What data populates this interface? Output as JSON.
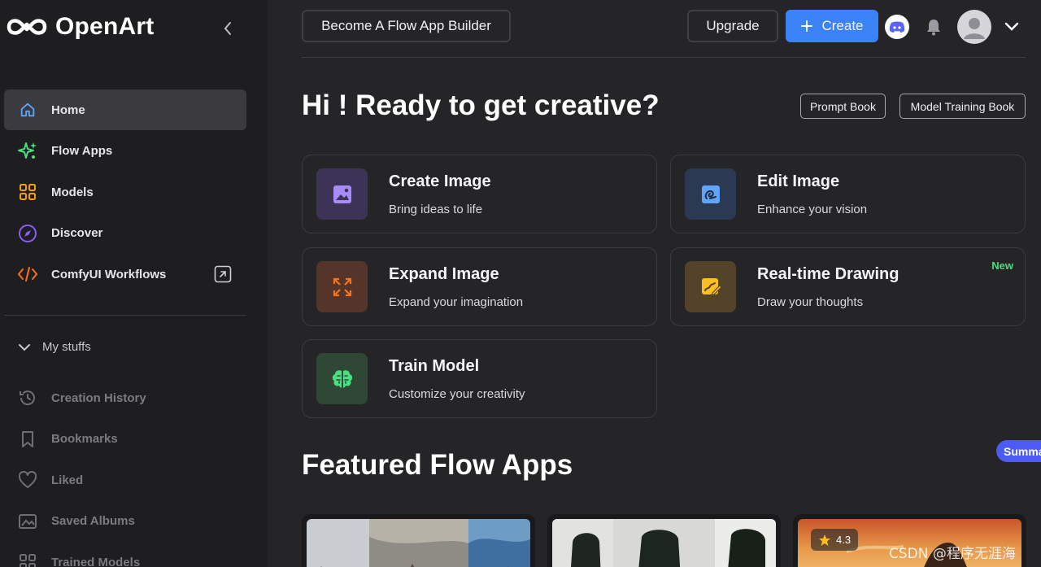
{
  "brand": {
    "name": "OpenArt"
  },
  "sidebar": {
    "nav": [
      {
        "label": "Home",
        "icon": "home-icon",
        "color": "#60a5fa"
      },
      {
        "label": "Flow Apps",
        "icon": "sparkle-icon",
        "color": "#4ade80"
      },
      {
        "label": "Models",
        "icon": "grid-icon",
        "color": "#f59e0b"
      },
      {
        "label": "Discover",
        "icon": "compass-icon",
        "color": "#8b5cf6"
      },
      {
        "label": "ComfyUI Workflows",
        "icon": "code-icon",
        "color": "#f97316"
      }
    ],
    "my_stuffs_label": "My stuffs",
    "stuffs": [
      {
        "label": "Creation History",
        "icon": "history-icon"
      },
      {
        "label": "Bookmarks",
        "icon": "bookmark-icon"
      },
      {
        "label": "Liked",
        "icon": "heart-icon"
      },
      {
        "label": "Saved Albums",
        "icon": "album-icon"
      },
      {
        "label": "Trained Models",
        "icon": "trained-models-icon"
      }
    ]
  },
  "topbar": {
    "builder_label": "Become A Flow App Builder",
    "upgrade_label": "Upgrade",
    "create_label": "Create",
    "accent": "#3b82f6"
  },
  "main": {
    "greeting": "Hi ! Ready to get creative?",
    "prompt_book": "Prompt Book",
    "model_training_book": "Model Training Book",
    "cards": [
      {
        "title": "Create Image",
        "desc": "Bring ideas to life",
        "icon": "image-icon",
        "bg": "#3d3356",
        "fg": "#a78bfa",
        "badge": ""
      },
      {
        "title": "Edit Image",
        "desc": "Enhance your vision",
        "icon": "edit-image-icon",
        "bg": "#2b3a52",
        "fg": "#60a5fa",
        "badge": ""
      },
      {
        "title": "Expand Image",
        "desc": "Expand your imagination",
        "icon": "expand-icon",
        "bg": "#553529",
        "fg": "#f97316",
        "badge": ""
      },
      {
        "title": "Real-time Drawing",
        "desc": "Draw your thoughts",
        "icon": "drawing-icon",
        "bg": "#52432a",
        "fg": "#fbbf24",
        "badge": "New"
      },
      {
        "title": "Train Model",
        "desc": "Customize your creativity",
        "icon": "brain-icon",
        "bg": "#2f4836",
        "fg": "#4ade80",
        "badge": ""
      }
    ],
    "featured_title": "Featured Flow Apps",
    "summary_tag": "Summa",
    "apps": [
      {
        "name": "app-houses",
        "rating": ""
      },
      {
        "name": "app-chairs",
        "rating": ""
      },
      {
        "name": "app-sunset",
        "rating": "4.3"
      }
    ]
  },
  "watermark": "CSDN @程序无涯海"
}
